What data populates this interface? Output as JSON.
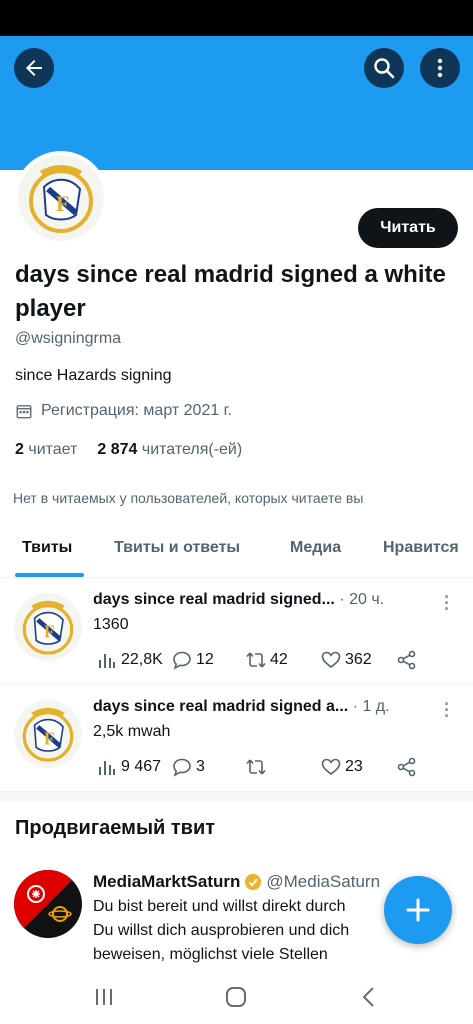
{
  "header": {
    "back_icon": "arrow-left-icon",
    "search_icon": "search-icon",
    "more_icon": "more-vertical-icon",
    "banner_color": "#1d9bf0"
  },
  "profile": {
    "name": "days since real madrid signed a white player",
    "handle": "@wsigningrma",
    "bio": "since Hazards signing",
    "joined": "Регистрация: март 2021 г.",
    "following_count": "2",
    "following_label": "читает",
    "followers_count": "2 874",
    "followers_label": "читателя(-ей)",
    "no_mutual_follows": "Нет в читаемых у пользователей, которых читаете вы",
    "follow_button": "Читать"
  },
  "tabs": [
    {
      "label": "Твиты",
      "active": true
    },
    {
      "label": "Твиты и ответы",
      "active": false
    },
    {
      "label": "Медиа",
      "active": false
    },
    {
      "label": "Нравится",
      "active": false
    }
  ],
  "tweets": [
    {
      "name": "days since real madrid signed...",
      "time": "· 20 ч.",
      "text": "1360",
      "views": "22,8K",
      "replies": "12",
      "retweets": "42",
      "likes": "362"
    },
    {
      "name": "days since real madrid signed a...",
      "time": "· 1 д.",
      "text": "2,5k mwah",
      "views": "9 467",
      "replies": "3",
      "retweets": "",
      "likes": "23"
    }
  ],
  "promoted": {
    "section_title": "Продвигаемый твит",
    "name": "MediaMarktSaturn",
    "handle": "@MediaSaturn",
    "verified_icon": "verified-badge-icon",
    "lines": [
      "Du bist bereit und willst direkt durch",
      "Du willst dich ausprobieren und dich",
      "beweisen, möglichst viele Stellen"
    ]
  },
  "fab": {
    "icon": "plus-icon"
  },
  "colors": {
    "accent": "#1d9bf0",
    "text": "#0f1419",
    "secondary": "#536471"
  }
}
